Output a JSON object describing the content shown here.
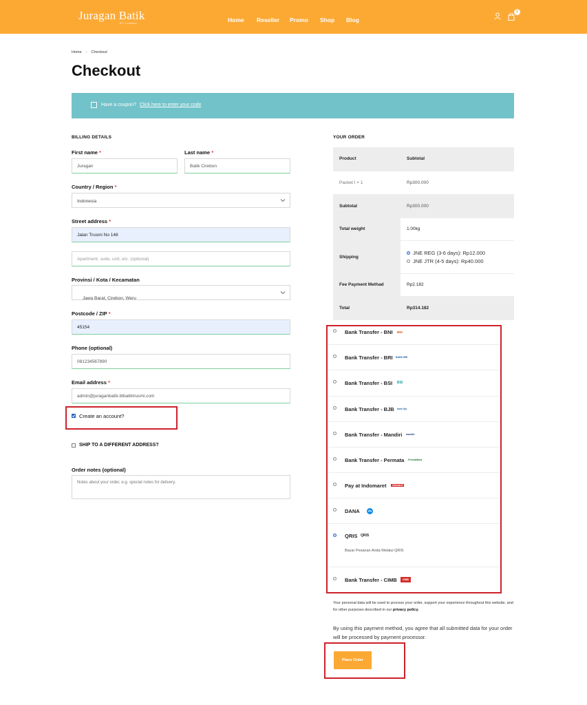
{
  "header": {
    "logo": "Juragan Batik",
    "logo_sub": "BT Cirebon",
    "nav": [
      "Home",
      "Reseller",
      "Promo",
      "Shop",
      "Blog"
    ],
    "cart_count": "1",
    "colors": {
      "brand": "#fca934",
      "coupon_bg": "#72c2c9",
      "highlight": "#cc2129"
    }
  },
  "breadcrumb": {
    "home": "Home",
    "sep": "›",
    "current": "Checkout"
  },
  "page_title": "Checkout",
  "coupon": {
    "text": "Have a coupon?",
    "link": "Click here to enter your code"
  },
  "billing": {
    "title": "BILLING DETAILS",
    "first_name": {
      "label": "First name",
      "value": "Juragan"
    },
    "last_name": {
      "label": "Last name",
      "value": "Batik Cirebon"
    },
    "country": {
      "label": "Country / Region",
      "value": "Indonesia"
    },
    "street": {
      "label": "Street address",
      "value": "Jalan Trusmi No 148",
      "placeholder2": "Apartment, suite, unit, etc. (optional)"
    },
    "province": {
      "label": "Provinsi / Kota / Kecamatan",
      "value": "Jawa Barat, Cirebon, Weru"
    },
    "postcode": {
      "label": "Postcode / ZIP",
      "value": "45154"
    },
    "phone": {
      "label": "Phone (optional)",
      "value": "081234567890"
    },
    "email": {
      "label": "Email address",
      "value": "admin@juraganbatik.btbatiktrusmi.com"
    },
    "create_account": "Create an account?",
    "ship_different": "SHIP TO A DIFFERENT ADDRESS?",
    "notes": {
      "label": "Order notes (optional)",
      "placeholder": "Notes about your order, e.g. special notes for delivery."
    }
  },
  "order": {
    "title": "YOUR ORDER",
    "head": {
      "product": "Product",
      "subtotal": "Subtotal"
    },
    "item": {
      "name": "Packet I",
      "qty": "× 1",
      "price": "Rp300.000"
    },
    "subtotal": {
      "label": "Subtotal",
      "value": "Rp300.000"
    },
    "weight": {
      "label": "Total weight",
      "value": "1.00kg"
    },
    "shipping": {
      "label": "Shipping",
      "options": [
        "JNE REG (3-6 days): Rp12.000",
        "JNE JTR (4-5 days): Rp40.000"
      ],
      "selected": 0
    },
    "fee": {
      "label": "Fee Payment Methad",
      "value": "Rp2.182"
    },
    "total": {
      "label": "Total",
      "value": "Rp314.182"
    }
  },
  "payments": {
    "methods": [
      {
        "name": "Bank Transfer - BNI",
        "logo": "BNI",
        "logo_color": "#e05a1d"
      },
      {
        "name": "Bank Transfer - BRI",
        "logo": "BANK BRI",
        "logo_color": "#1f5fa8"
      },
      {
        "name": "Bank Transfer - BSI",
        "logo": "BSI",
        "logo_color": "#1aa39a"
      },
      {
        "name": "Bank Transfer - BJB",
        "logo": "bank bjb",
        "logo_color": "#2a6cb3"
      },
      {
        "name": "Bank Transfer - Mandiri",
        "logo": "mandiri",
        "logo_color": "#1c3b78"
      },
      {
        "name": "Bank Transfer - Permata",
        "logo": "PermataBank",
        "logo_color": "#2b7c3f"
      },
      {
        "name": "Pay at Indomaret",
        "logo": "Indomaret",
        "logo_color": "#d62a2a"
      },
      {
        "name": "DANA",
        "logo": "",
        "logo_color": "#118ee9"
      },
      {
        "name": "QRIS",
        "logo": "QRIS",
        "logo_color": "#222222",
        "description": "Bayar Pesanan Anda Melalui QRIS"
      },
      {
        "name": "Bank Transfer - CIMB",
        "logo": "CIMB",
        "logo_color": "#d4302b"
      }
    ],
    "selected": 8
  },
  "privacy": {
    "text": "Your personal data will be used to process your order, support your experience throughout this website, and for other purposes described in our",
    "link": "privacy policy."
  },
  "agree_text": "By using this payment method, you agree that all submitted data for your order will be processed by payment processor.",
  "place_order": "Place Order"
}
